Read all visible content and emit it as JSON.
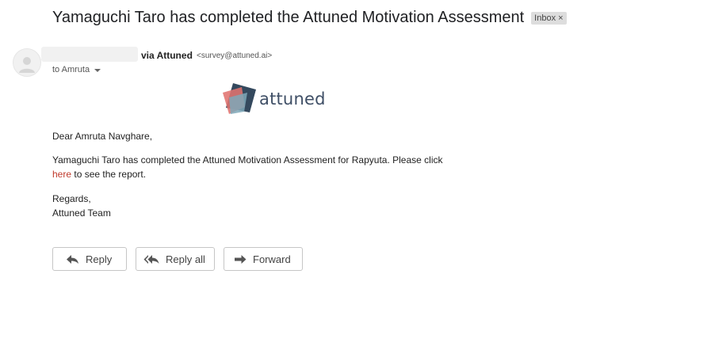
{
  "email": {
    "subject": "Yamaguchi Taro has completed the Attuned Motivation Assessment",
    "label": "Inbox",
    "label_remove": "×",
    "sender_via": "via Attuned",
    "sender_email": "<survey@attuned.ai>",
    "to_line": "to Amruta"
  },
  "logo": {
    "wordmark": "attuned"
  },
  "message": {
    "greeting": "Dear Amruta Navghare,",
    "line1": "Yamaguchi Taro has completed the Attuned Motivation Assessment for Rapyuta. Please click",
    "link_text": "here",
    "line2_rest": " to see the report.",
    "regards": "Regards,",
    "signature": "Attuned Team"
  },
  "actions": {
    "reply": "Reply",
    "reply_all": "Reply all",
    "forward": "Forward"
  },
  "icons": {
    "avatar": "person-icon",
    "reply": "reply-icon",
    "reply_all": "reply-all-icon",
    "forward": "forward-icon",
    "to_dropdown": "chevron-down-icon"
  },
  "colors": {
    "link": "#c0392b",
    "logo_text": "#3f4f66",
    "logo_red": "#e0736f",
    "logo_navy": "#34495e",
    "logo_teal": "#7fa8b8"
  }
}
